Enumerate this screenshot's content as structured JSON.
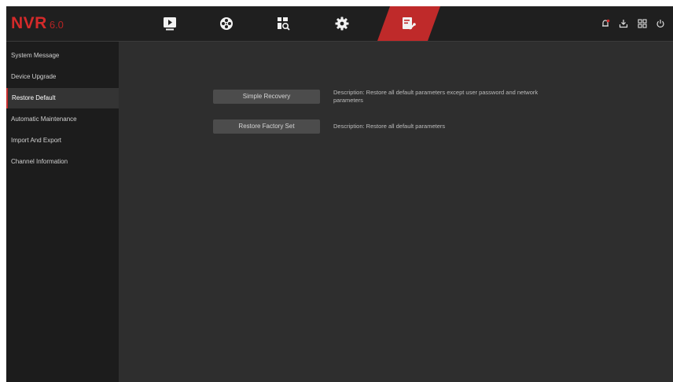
{
  "app": {
    "logo_brand": "NVR",
    "logo_version": "6.0"
  },
  "nav": {
    "tabs": [
      {
        "name": "playback",
        "icon": "play-icon"
      },
      {
        "name": "ai",
        "icon": "film-reel-icon"
      },
      {
        "name": "search",
        "icon": "file-search-icon"
      },
      {
        "name": "settings",
        "icon": "gear-icon"
      },
      {
        "name": "maintenance",
        "icon": "maintenance-icon",
        "active": true
      }
    ],
    "right_icons": [
      "alarm-bell-icon",
      "download-icon",
      "grid-view-icon",
      "power-icon"
    ]
  },
  "sidebar": {
    "items": [
      {
        "label": "System Message"
      },
      {
        "label": "Device Upgrade"
      },
      {
        "label": "Restore Default",
        "active": true
      },
      {
        "label": "Automatic Maintenance"
      },
      {
        "label": "Import And Export"
      },
      {
        "label": "Channel Information"
      }
    ]
  },
  "main": {
    "simple_recovery_label": "Simple Recovery",
    "simple_recovery_desc": "Description: Restore all default parameters except user password and network parameters",
    "factory_label": "Restore Factory Set",
    "factory_desc": "Description: Restore all default parameters"
  },
  "colors": {
    "accent": "#c62b2b",
    "background": "#2e2e2e",
    "topbar": "#1f1f1f",
    "sidebar": "#1c1c1c"
  }
}
